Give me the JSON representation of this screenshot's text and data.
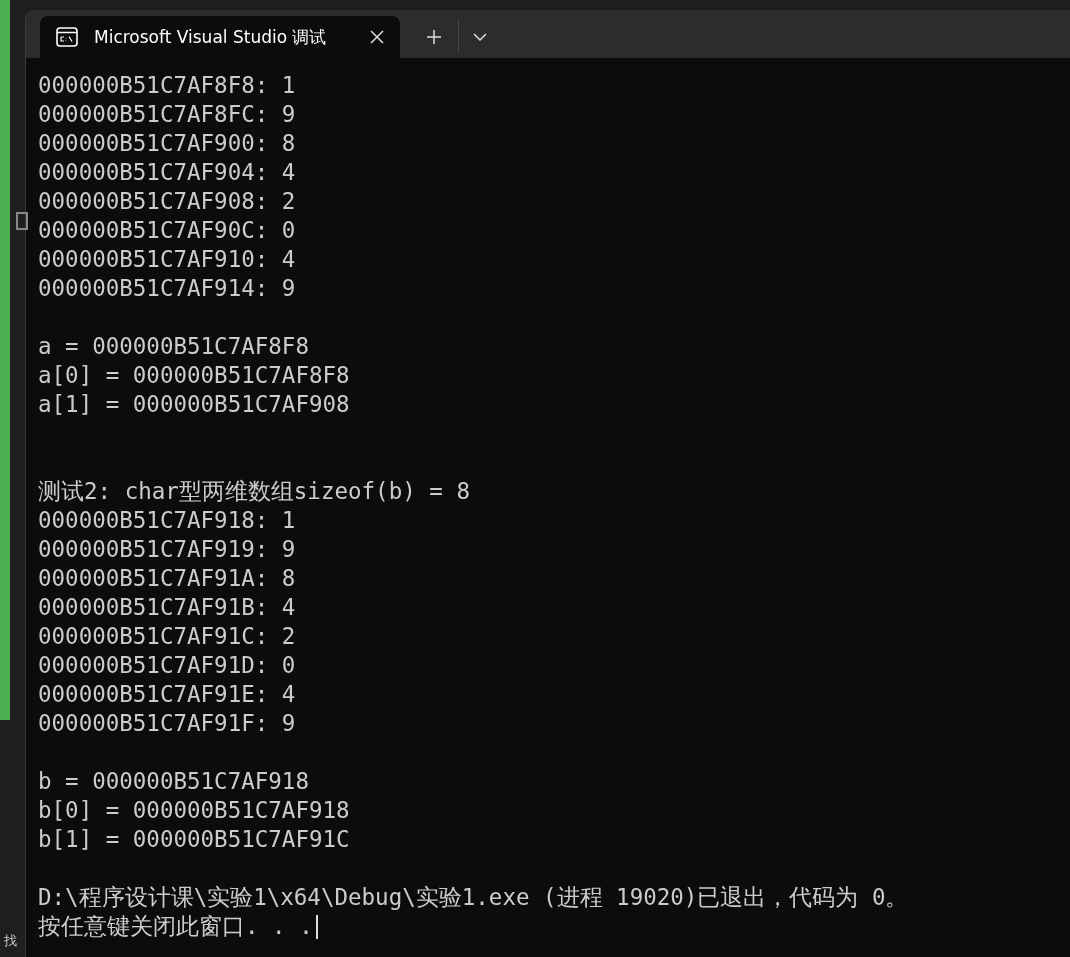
{
  "background": {
    "taskbar_text": "找"
  },
  "tab": {
    "title": "Microsoft Visual Studio 调试",
    "selected": true
  },
  "console": {
    "blocks": [
      {
        "kind": "tight",
        "lines": [
          "000000B51C7AF8F8: 1",
          "000000B51C7AF8FC: 9",
          "000000B51C7AF900: 8",
          "000000B51C7AF904: 4",
          "000000B51C7AF908: 2",
          "000000B51C7AF90C: 0",
          "000000B51C7AF910: 4",
          "000000B51C7AF914: 9"
        ]
      },
      {
        "kind": "spaced",
        "lines": [
          "a = 000000B51C7AF8F8",
          "a[0] = 000000B51C7AF8F8",
          "a[1] = 000000B51C7AF908"
        ]
      },
      {
        "kind": "wide",
        "lines": [
          "测试2: char型两维数组sizeof(b) = 8",
          "000000B51C7AF918: 1",
          "000000B51C7AF919: 9",
          "000000B51C7AF91A: 8",
          "000000B51C7AF91B: 4",
          "000000B51C7AF91C: 2",
          "000000B51C7AF91D: 0",
          "000000B51C7AF91E: 4",
          "000000B51C7AF91F: 9"
        ]
      },
      {
        "kind": "spaced",
        "lines": [
          "b = 000000B51C7AF918",
          "b[0] = 000000B51C7AF918",
          "b[1] = 000000B51C7AF91C"
        ]
      },
      {
        "kind": "spaced",
        "lines": [
          "D:\\程序设计课\\实验1\\x64\\Debug\\实验1.exe (进程 19020)已退出，代码为 0。",
          "按任意键关闭此窗口. . ."
        ]
      }
    ],
    "cursor": true
  }
}
